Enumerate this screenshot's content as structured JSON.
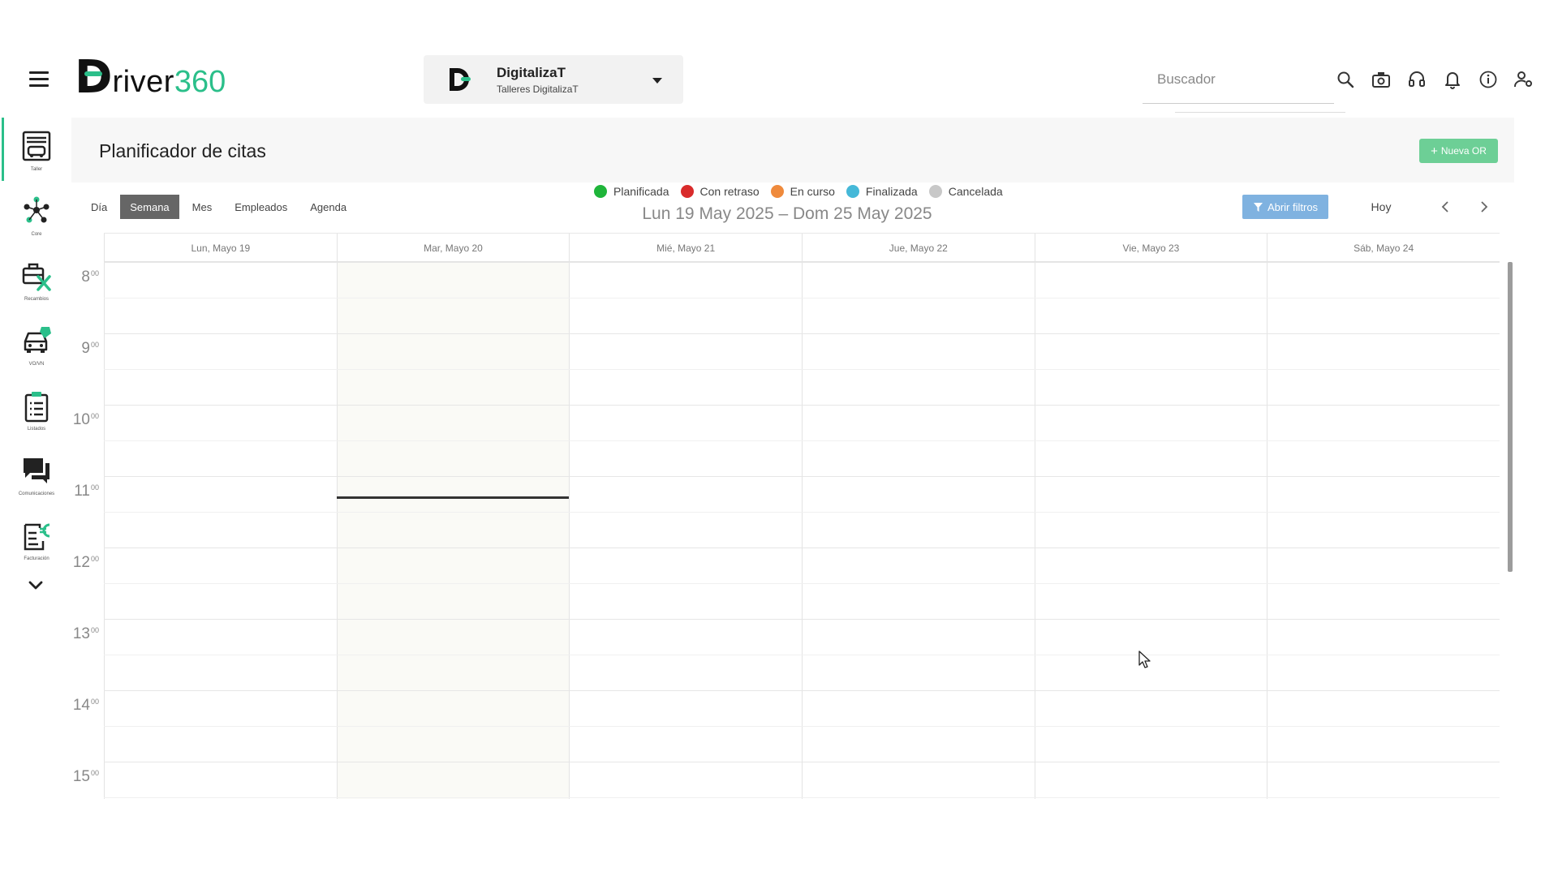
{
  "brand": {
    "logo_d": "D",
    "logo_rest": "river",
    "logo_num": "360"
  },
  "company": {
    "name": "DigitalizaT",
    "subtitle": "Talleres DigitalizaT"
  },
  "search": {
    "placeholder": "Buscador"
  },
  "top_icons": [
    "search-icon",
    "vehicle-camera-icon",
    "headset-icon",
    "bell-icon",
    "info-icon",
    "user-settings-icon",
    "more-vertical-icon"
  ],
  "sidebar": {
    "items": [
      {
        "label": "Taller",
        "icon": "garage-icon",
        "active": true
      },
      {
        "label": "Core",
        "icon": "network-icon"
      },
      {
        "label": "Recambios",
        "icon": "parts-icon"
      },
      {
        "label": "VO/VN",
        "icon": "car-tag-icon"
      },
      {
        "label": "Listados",
        "icon": "clipboard-list-icon"
      },
      {
        "label": "Comunicaciones",
        "icon": "chat-icon"
      },
      {
        "label": "Facturación",
        "icon": "invoice-euro-icon"
      }
    ]
  },
  "page": {
    "title": "Planificador de citas",
    "new_button": "Nueva OR"
  },
  "views": [
    {
      "label": "Día",
      "active": false
    },
    {
      "label": "Semana",
      "active": true
    },
    {
      "label": "Mes",
      "active": false
    },
    {
      "label": "Empleados",
      "active": false
    },
    {
      "label": "Agenda",
      "active": false
    }
  ],
  "legend": [
    {
      "label": "Planificada",
      "color": "#1fb53a"
    },
    {
      "label": "Con retraso",
      "color": "#d92b2b"
    },
    {
      "label": "En curso",
      "color": "#ef8a3c"
    },
    {
      "label": "Finalizada",
      "color": "#45b8d8"
    },
    {
      "label": "Cancelada",
      "color": "#c8c8c8"
    }
  ],
  "range_title": "Lun 19 May 2025 – Dom 25 May 2025",
  "toolbar": {
    "filters": "Abrir filtros",
    "today": "Hoy"
  },
  "days": [
    "Lun, Mayo 19",
    "Mar, Mayo 20",
    "Mié, Mayo 21",
    "Jue, Mayo 22",
    "Vie, Mayo 23",
    "Sáb, Mayo 24"
  ],
  "today_index": 1,
  "hours": [
    {
      "hour": "8",
      "min": "00"
    },
    {
      "hour": "9",
      "min": "00"
    },
    {
      "hour": "10",
      "min": "00"
    },
    {
      "hour": "11",
      "min": "00"
    },
    {
      "hour": "12",
      "min": "00"
    },
    {
      "hour": "13",
      "min": "00"
    },
    {
      "hour": "14",
      "min": "00"
    },
    {
      "hour": "15",
      "min": "00"
    }
  ],
  "current_time_hour": 11.1
}
